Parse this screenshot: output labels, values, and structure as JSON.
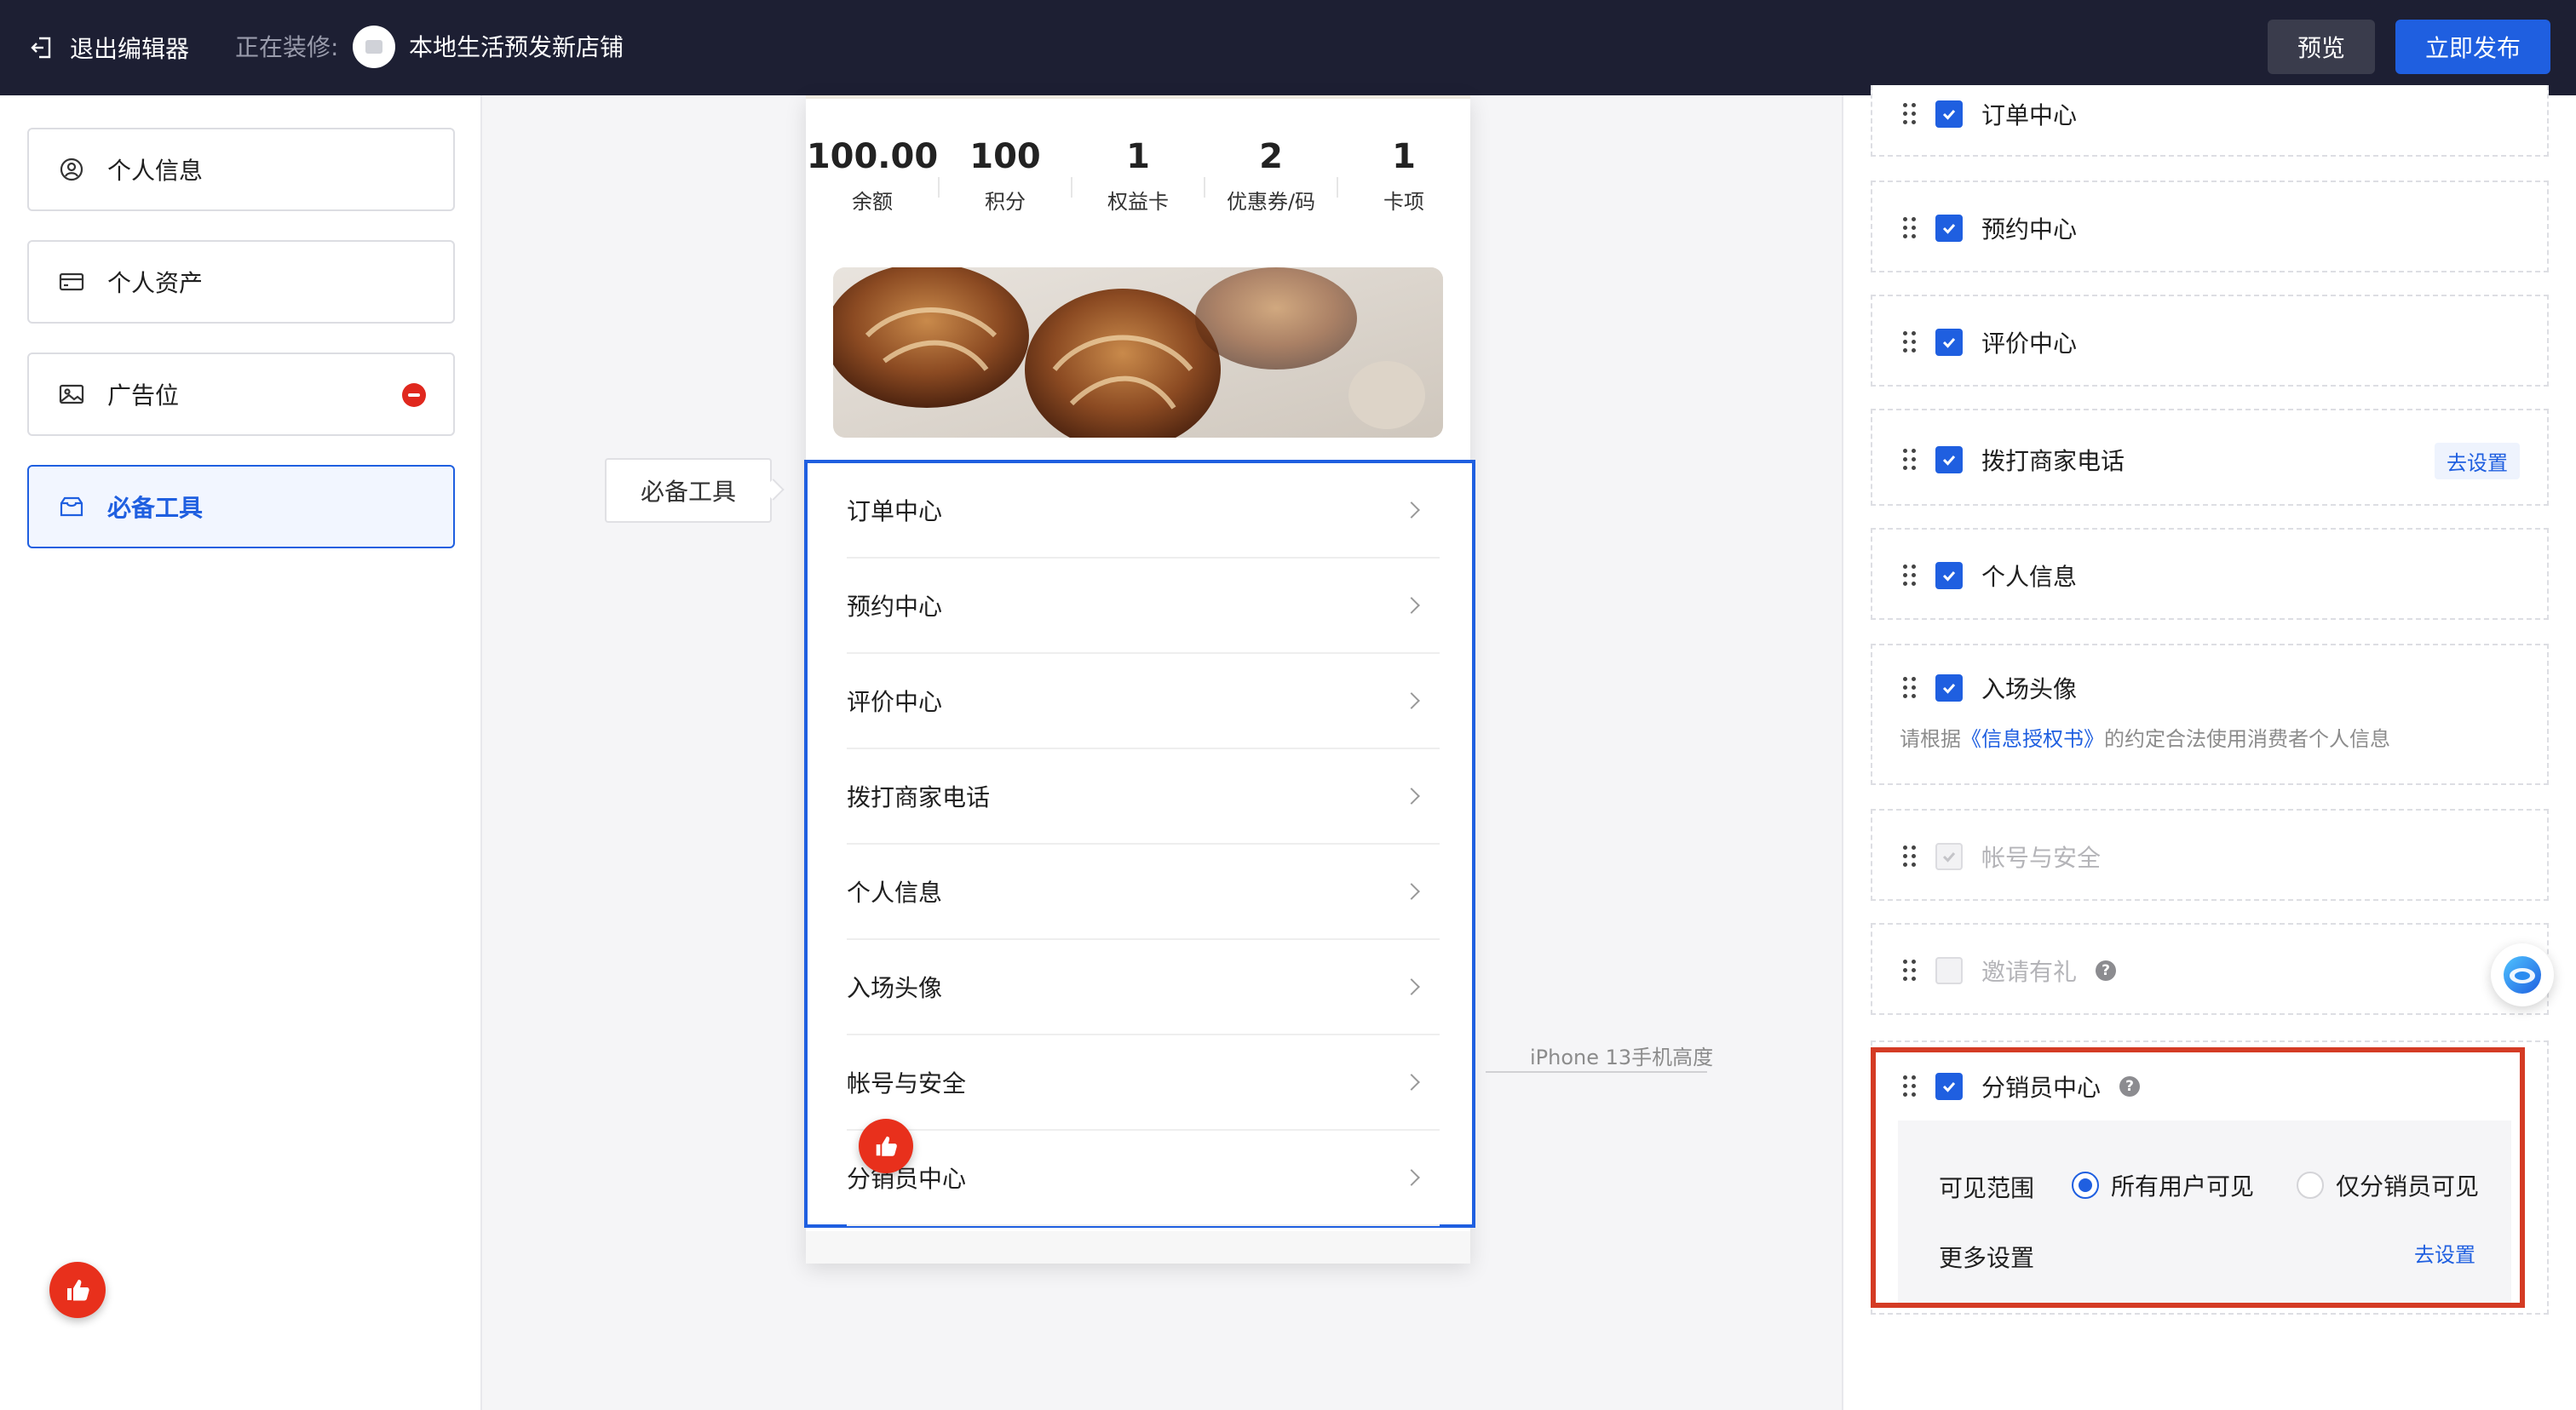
{
  "header": {
    "exit_label": "退出编辑器",
    "editing_label": "正在装修:",
    "shop_name": "本地生活预发新店铺",
    "preview_label": "预览",
    "publish_label": "立即发布"
  },
  "sidebar": {
    "items": [
      {
        "label": "个人信息",
        "icon": "user-circle-icon"
      },
      {
        "label": "个人资产",
        "icon": "card-icon"
      },
      {
        "label": "广告位",
        "icon": "image-icon"
      },
      {
        "label": "必备工具",
        "icon": "toolbox-icon",
        "active": true
      }
    ]
  },
  "phone": {
    "stats": [
      {
        "value": "100.00",
        "label": "余额"
      },
      {
        "value": "100",
        "label": "积分"
      },
      {
        "value": "1",
        "label": "权益卡"
      },
      {
        "value": "2",
        "label": "优惠券/码"
      },
      {
        "value": "1",
        "label": "卡项"
      }
    ],
    "block_tag": "必备工具",
    "menu": [
      "订单中心",
      "预约中心",
      "评价中心",
      "拨打商家电话",
      "个人信息",
      "入场头像",
      "帐号与安全",
      "分销员中心"
    ],
    "height_marker": "iPhone 13手机高度"
  },
  "settings": {
    "rows": [
      {
        "label": "订单中心",
        "checked": true
      },
      {
        "label": "预约中心",
        "checked": true
      },
      {
        "label": "评价中心",
        "checked": true
      },
      {
        "label": "拨打商家电话",
        "checked": true,
        "action": "去设置"
      },
      {
        "label": "个人信息",
        "checked": true
      },
      {
        "label": "入场头像",
        "checked": true
      },
      {
        "label": "帐号与安全",
        "checked": true,
        "disabled": true
      },
      {
        "label": "邀请有礼",
        "checked": false,
        "disabled": true
      },
      {
        "label": "分销员中心",
        "checked": true
      }
    ],
    "auth_note_pre": "请根据",
    "auth_note_link": "《信息授权书》",
    "auth_note_post": "的约定合法使用消费者个人信息",
    "help_glyph": "?",
    "visibility_label": "可见范围",
    "visibility_options": [
      "所有用户可见",
      "仅分销员可见"
    ],
    "visibility_selected": "所有用户可见",
    "more_settings_label": "更多设置",
    "more_settings_action": "去设置"
  },
  "colors": {
    "accent": "#1f5fe0",
    "topbar": "#1d1f33",
    "highlight": "#d43b24",
    "danger": "#e0281e"
  }
}
